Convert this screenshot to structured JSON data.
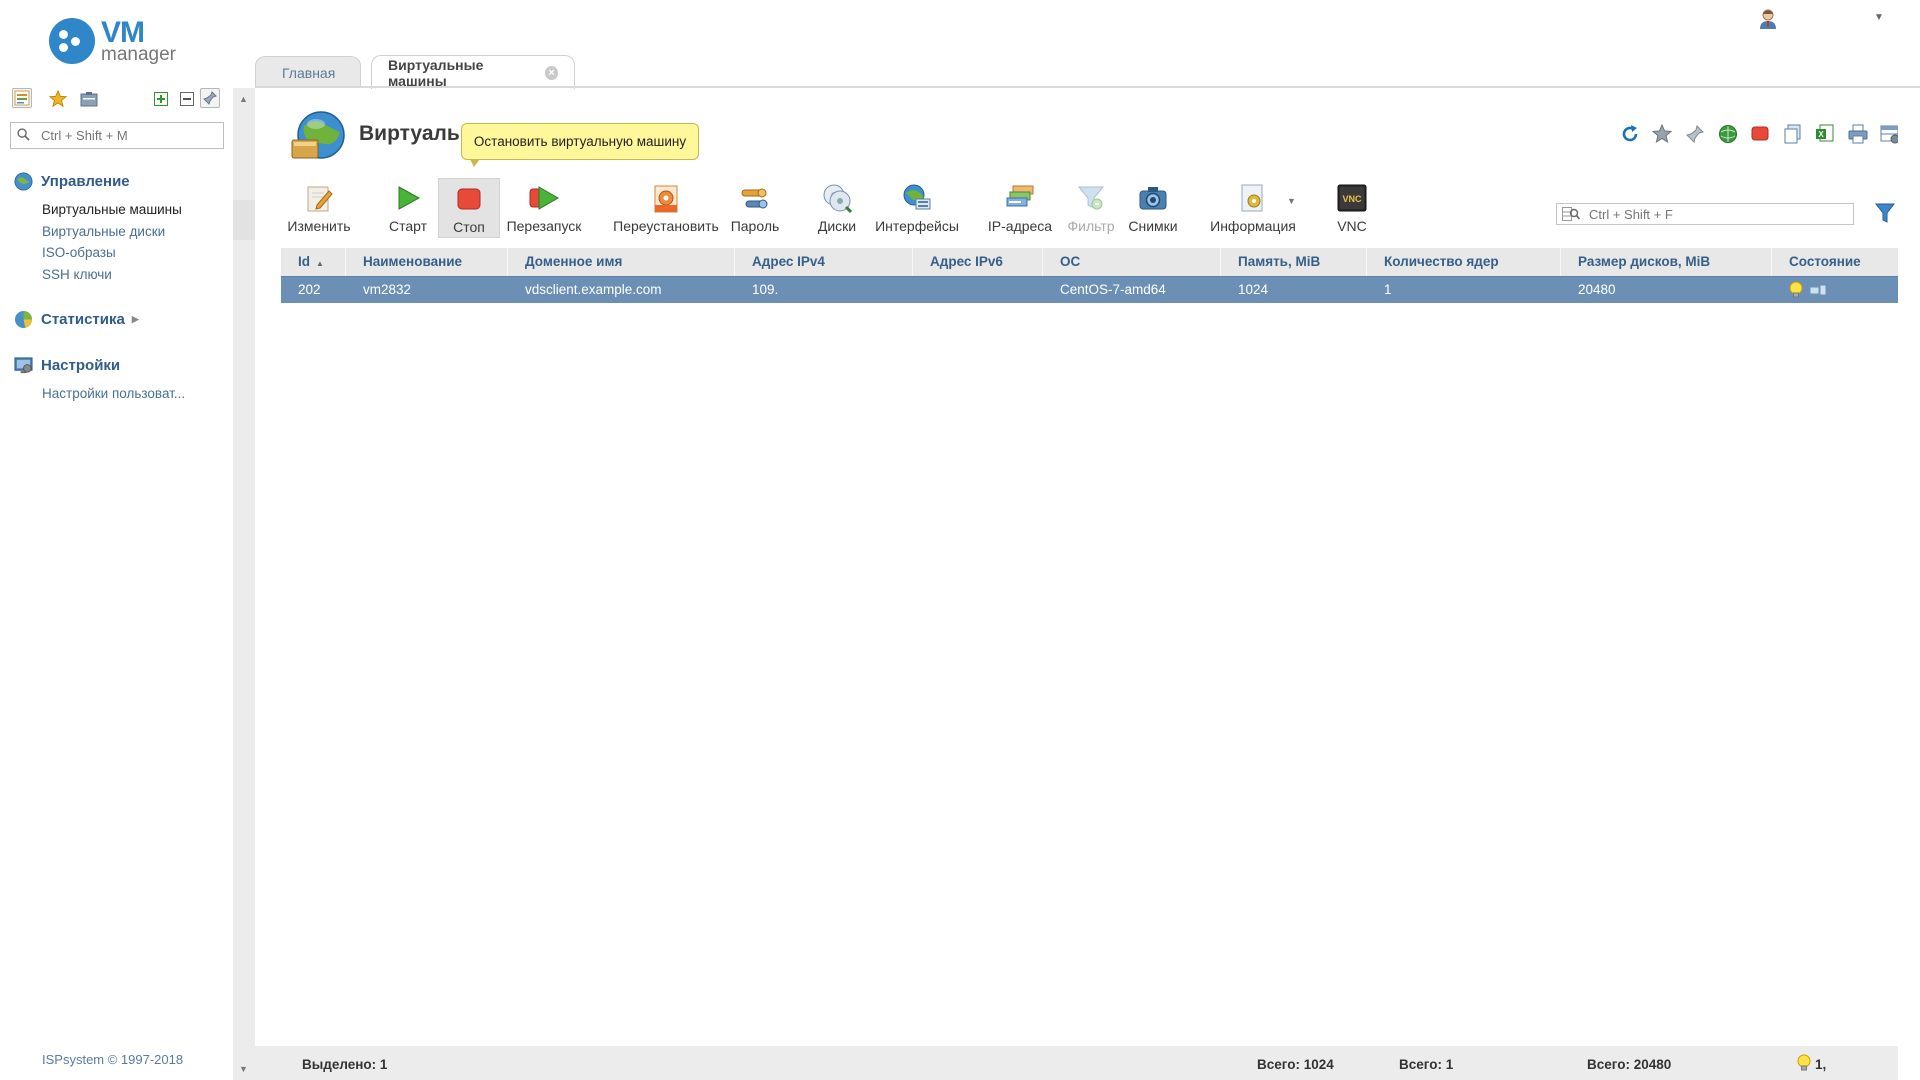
{
  "app": {
    "logo_vm": "VM",
    "logo_manager": "manager"
  },
  "sidebar": {
    "search_placeholder": "Ctrl + Shift + M",
    "groups": [
      {
        "label": "Управление",
        "items": [
          "Виртуальные машины",
          "Виртуальные диски",
          "ISO-образы",
          "SSH ключи"
        ]
      },
      {
        "label": "Статистика",
        "items": []
      },
      {
        "label": "Настройки",
        "items": [
          "Настройки пользоват..."
        ]
      }
    ],
    "copyright": "ISPsystem © 1997-2018"
  },
  "tabs": [
    {
      "label": "Главная",
      "active": false
    },
    {
      "label": "Виртуальные машины",
      "active": true
    }
  ],
  "page": {
    "title": "Виртуальные машины",
    "tooltip": "Остановить виртуальную машину",
    "filter_placeholder": "Ctrl + Shift + F"
  },
  "toolbar": [
    {
      "label": "Изменить",
      "icon": "edit-icon"
    },
    {
      "label": "Старт",
      "icon": "play-icon"
    },
    {
      "label": "Стоп",
      "icon": "stop-icon"
    },
    {
      "label": "Перезапуск",
      "icon": "restart-icon"
    },
    {
      "label": "Переустановить",
      "icon": "reinstall-icon"
    },
    {
      "label": "Пароль",
      "icon": "password-icon"
    },
    {
      "label": "Диски",
      "icon": "disks-icon"
    },
    {
      "label": "Интерфейсы",
      "icon": "interfaces-icon"
    },
    {
      "label": "IP-адреса",
      "icon": "ip-addresses-icon"
    },
    {
      "label": "Фильтр",
      "icon": "filter-icon",
      "disabled": true
    },
    {
      "label": "Снимки",
      "icon": "camera-icon"
    },
    {
      "label": "Информация",
      "icon": "info-icon"
    },
    {
      "label": "VNC",
      "icon": "vnc-icon"
    }
  ],
  "table": {
    "columns": [
      "Id",
      "Наименование",
      "Доменное имя",
      "Адрес IPv4",
      "Адрес IPv6",
      "ОС",
      "Память, MiB",
      "Количество ядер",
      "Размер дисков, MiB",
      "Состояние"
    ],
    "rows": [
      {
        "cells": [
          "202",
          "vm2832",
          "vdsclient.example.com",
          "109.",
          "",
          "CentOS-7-amd64",
          "1024",
          "1",
          "20480",
          ""
        ]
      }
    ]
  },
  "footer": {
    "selected": "Выделено: 1",
    "total_memory": "Всего: 1024",
    "total_cores": "Всего: 1",
    "total_disks": "Всего: 20480",
    "status_count": "1,"
  },
  "colors": {
    "accent": "#2f86c9",
    "row_selected": "#6b8fb5",
    "header_text": "#365f8a",
    "tooltip_bg": "#fff79a"
  }
}
